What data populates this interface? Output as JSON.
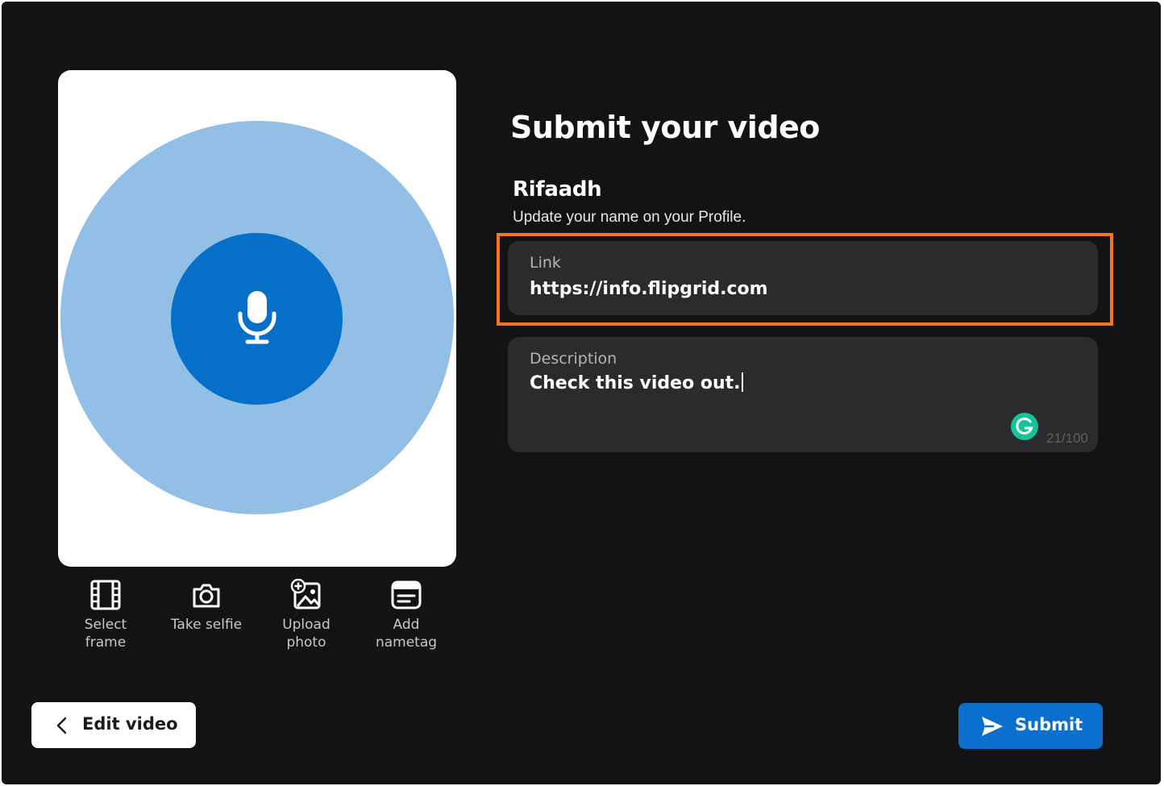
{
  "page": {
    "title": "Submit your video"
  },
  "preview": {
    "placeholder_icon": "microphone-icon",
    "colors": {
      "outer": "#91bfe5",
      "inner": "#0670c8"
    }
  },
  "tools": [
    {
      "label": "Select\nframe",
      "icon": "film-frame-icon"
    },
    {
      "label": "Take selfie",
      "icon": "camera-icon"
    },
    {
      "label": "Upload\nphoto",
      "icon": "image-add-icon"
    },
    {
      "label": "Add\nnametag",
      "icon": "nametag-icon"
    }
  ],
  "user": {
    "name": "Rifaadh",
    "profile_hint": "Update your name on your Profile."
  },
  "link_field": {
    "label": "Link",
    "value": "https://info.flipgrid.com"
  },
  "description_field": {
    "label": "Description",
    "value": "Check this video out.",
    "counter": "21/100"
  },
  "buttons": {
    "edit_video": "Edit video",
    "submit": "Submit"
  },
  "colors": {
    "background": "#131315",
    "highlight": "#f5751f",
    "submit": "#0b6fcd",
    "grammarly": "#15c39a"
  }
}
